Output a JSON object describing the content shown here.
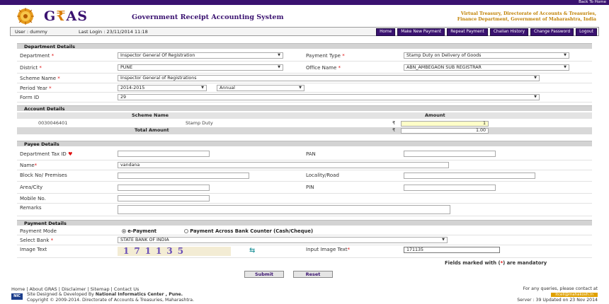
{
  "topbar": {
    "back_label": "Back To Home"
  },
  "header": {
    "logo_left": "G",
    "logo_mid": "₹",
    "logo_right": "AS",
    "app_title": "Government Receipt Accounting System",
    "right_line1": "Virtual Treasury, Directorate of Accounts & Treasuries,",
    "right_line2": "Finance Department, Government of Maharashtra, India"
  },
  "navbar": {
    "user": "User : dummy",
    "last_login": "Last Login : 23/11/2014 11:18",
    "buttons": [
      "Home",
      "Make New Payment",
      "Repeat Payment",
      "Challan History",
      "Change Password",
      "Logout"
    ]
  },
  "department": {
    "section_title": "Department Details",
    "department_label": "Department",
    "department_value": "Inspector General Of Registration",
    "payment_type_label": "Payment Type",
    "payment_type_value": "Stamp Duty on Delivery of Goods",
    "district_label": "District",
    "district_value": "PUNE",
    "office_label": "Office Name",
    "office_value": "ABN_AMBEGAON SUB REGISTRAR",
    "scheme_label": "Scheme Name",
    "scheme_value": "Inspector General of Registrations",
    "period_label": "Period Year",
    "period_year": "2014-2015",
    "period_type": "Annual",
    "form_label": "Form ID",
    "form_value": "29",
    "req_mark": "*"
  },
  "account": {
    "section_title": "Account Details",
    "col_scheme": "Scheme Name",
    "col_amount": "Amount",
    "rows": [
      {
        "code": "0030046401",
        "name": "Stamp Duty",
        "currency": "₹",
        "amount": "1"
      }
    ],
    "total_label": "Total Amount",
    "total_currency": "₹",
    "total_value": "1.00"
  },
  "payee": {
    "section_title": "Payee Details",
    "tax_id_label": "Department Tax ID",
    "pan_label": "PAN",
    "name_label": "Name",
    "name_value": "vandana",
    "block_label": "Block No/ Premises",
    "locality_label": "Locality/Road",
    "area_label": "Area/City",
    "pin_label": "PIN",
    "mobile_label": "Mobile No.",
    "remarks_label": "Remarks"
  },
  "payment": {
    "section_title": "Payment Details",
    "mode_label": "Payment Mode",
    "mode_epayment": "e-Payment",
    "mode_counter": "Payment Across Bank Counter (Cash/Cheque)",
    "bank_label": "Select Bank",
    "bank_value": "STATE BANK OF INDIA",
    "image_text_label": "Image Text",
    "captcha": "171135",
    "refresh_glyph": "⇆",
    "input_image_label": "Input Image Text",
    "input_image_value": "171135",
    "mandatory_prefix": "Fields marked with (",
    "mandatory_star": "*",
    "mandatory_suffix": ") are mandatory"
  },
  "actions": {
    "submit": "Submit",
    "reset": "Reset"
  },
  "footer": {
    "links": "Home | About GRAS | Disclaimer | Sitemap | Contact Us",
    "nic": "NIC",
    "dev_prefix": "Site Designed & Developed By ",
    "dev_org": "National Informatics Center , Pune.",
    "copyright": "Copyright © 2009-2014. Directorate of Accounts & Treasuries, Maharashtra.",
    "query": "For any queries, please contact at",
    "email": "itcell@mahakosh.in",
    "server": "Server : 39 Updated on 23 Nov 2014"
  }
}
